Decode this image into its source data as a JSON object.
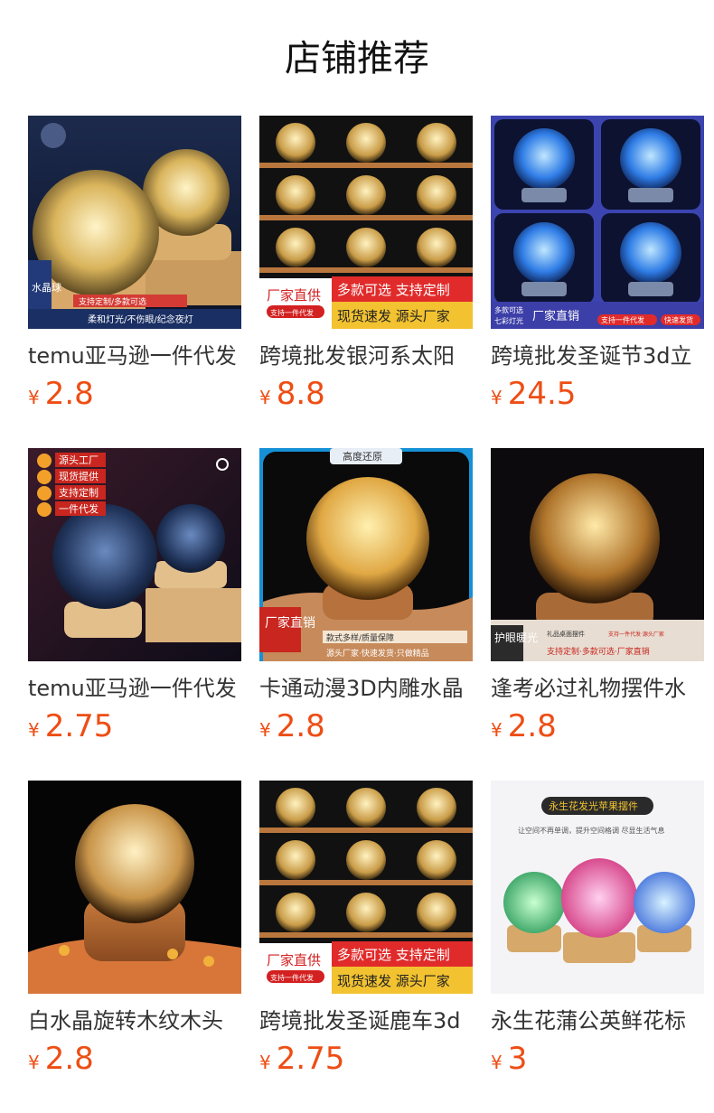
{
  "header": {
    "title": "店铺推荐"
  },
  "products": [
    {
      "name": "temu亚马逊一件代发",
      "currency": "¥",
      "price": "2.8",
      "badges": [
        "水晶球",
        "支持定制/多款可选",
        "柔和灯光/不伤眼/纪念夜灯"
      ]
    },
    {
      "name": "跨境批发银河系太阳",
      "currency": "¥",
      "price": "8.8",
      "badges": [
        "厂家直供",
        "支持一件代发",
        "多款可选 支持定制",
        "现货速发 源头厂家"
      ]
    },
    {
      "name": "跨境批发圣诞节3d立",
      "currency": "¥",
      "price": "24.5",
      "badges": [
        "多款可选",
        "七彩灯光",
        "厂家直销",
        "支持一件代发",
        "快速发货"
      ]
    },
    {
      "name": "temu亚马逊一件代发",
      "currency": "¥",
      "price": "2.75",
      "badges": [
        "源头工厂",
        "现货提供",
        "支持定制",
        "一件代发"
      ]
    },
    {
      "name": "卡通动漫3D内雕水晶",
      "currency": "¥",
      "price": "2.8",
      "badges": [
        "高度还原",
        "厂家直销",
        "款式多样/质量保障",
        "源头厂家·快速发货·只做精品"
      ]
    },
    {
      "name": "逢考必过礼物摆件水",
      "currency": "¥",
      "price": "2.8",
      "badges": [
        "护眼暖光",
        "礼品桌面摆件",
        "支持一件代发·源头厂家",
        "支持定制·多款可选·厂家直销"
      ]
    },
    {
      "name": "白水晶旋转木纹木头",
      "currency": "¥",
      "price": "2.8",
      "badges": []
    },
    {
      "name": "跨境批发圣诞鹿车3d",
      "currency": "¥",
      "price": "2.75",
      "badges": [
        "厂家直供",
        "支持一件代发",
        "多款可选 支持定制",
        "现货速发 源头厂家"
      ]
    },
    {
      "name": "永生花蒲公英鲜花标",
      "currency": "¥",
      "price": "3",
      "badges": [
        "永生花发光苹果摆件",
        "让空间不再单调，提升空间格调 尽显生活气息"
      ]
    }
  ],
  "colors": {
    "price": "#ee4d14",
    "title": "#111111"
  }
}
